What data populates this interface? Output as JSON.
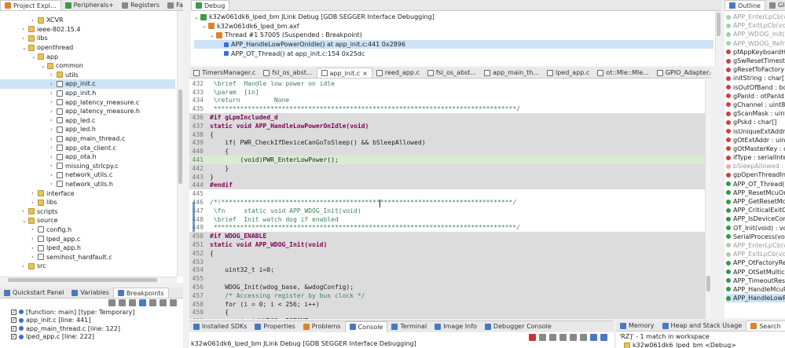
{
  "left_panel": {
    "tabs": [
      "Project Expl...",
      "Peripherals+",
      "Registers",
      "Faults"
    ],
    "tree": [
      {
        "label": "XCVR",
        "indent": 2,
        "arrow": "›",
        "icon": "folder"
      },
      {
        "label": "ieee-802.15.4",
        "indent": 1,
        "arrow": "›",
        "icon": "folder"
      },
      {
        "label": "libs",
        "indent": 1,
        "arrow": "›",
        "icon": "folder"
      },
      {
        "label": "openthread",
        "indent": 1,
        "arrow": "⌄",
        "icon": "folder"
      },
      {
        "label": "app",
        "indent": 2,
        "arrow": "⌄",
        "icon": "folder"
      },
      {
        "label": "common",
        "indent": 3,
        "arrow": "⌄",
        "icon": "folder"
      },
      {
        "label": "utils",
        "indent": 4,
        "arrow": "›",
        "icon": "folder"
      },
      {
        "label": "app_init.c",
        "indent": 4,
        "arrow": "›",
        "icon": "file",
        "selected": true
      },
      {
        "label": "app_init.h",
        "indent": 4,
        "arrow": "›",
        "icon": "h"
      },
      {
        "label": "app_latency_measure.c",
        "indent": 4,
        "arrow": "›",
        "icon": "file"
      },
      {
        "label": "app_latency_measure.h",
        "indent": 4,
        "arrow": "›",
        "icon": "h"
      },
      {
        "label": "app_led.c",
        "indent": 4,
        "arrow": "›",
        "icon": "file"
      },
      {
        "label": "app_led.h",
        "indent": 4,
        "arrow": "›",
        "icon": "h"
      },
      {
        "label": "app_main_thread.c",
        "indent": 4,
        "arrow": "›",
        "icon": "file"
      },
      {
        "label": "app_ota_client.c",
        "indent": 4,
        "arrow": "›",
        "icon": "file"
      },
      {
        "label": "app_ota.h",
        "indent": 4,
        "arrow": "›",
        "icon": "h"
      },
      {
        "label": "missing_strlcpy.c",
        "indent": 4,
        "arrow": "›",
        "icon": "file"
      },
      {
        "label": "network_utils.c",
        "indent": 4,
        "arrow": "›",
        "icon": "file"
      },
      {
        "label": "network_utils.h",
        "indent": 4,
        "arrow": "›",
        "icon": "h"
      },
      {
        "label": "interface",
        "indent": 2,
        "arrow": "›",
        "icon": "folder"
      },
      {
        "label": "libs",
        "indent": 2,
        "arrow": "›",
        "icon": "folder"
      },
      {
        "label": "scripts",
        "indent": 1,
        "arrow": "›",
        "icon": "folder"
      },
      {
        "label": "source",
        "indent": 1,
        "arrow": "⌄",
        "icon": "folder"
      },
      {
        "label": "config.h",
        "indent": 2,
        "arrow": "›",
        "icon": "h"
      },
      {
        "label": "lped_app.c",
        "indent": 2,
        "arrow": "›",
        "icon": "file"
      },
      {
        "label": "lped_app.h",
        "indent": 2,
        "arrow": "›",
        "icon": "h"
      },
      {
        "label": "semihost_hardfault.c",
        "indent": 2,
        "arrow": "›",
        "icon": "file"
      },
      {
        "label": "src",
        "indent": 1,
        "arrow": "›",
        "icon": "folder"
      }
    ]
  },
  "quickstart": {
    "tabs": [
      "Quickstart Panel",
      "Variables",
      "Breakpoints"
    ],
    "breakpoints": [
      {
        "label": "[function: main] [type: Temporary]"
      },
      {
        "label": "app_init.c [line: 441]"
      },
      {
        "label": "app_main_thread.c [line: 122]"
      },
      {
        "label": "lped_app.c [line: 222]"
      }
    ]
  },
  "debug": {
    "tab": "Debug",
    "rows": [
      {
        "label": "k32w061dk6_lped_bm JLink Debug [GDB SEGGER Interface Debugging]",
        "indent": 0,
        "arrow": "⌄"
      },
      {
        "label": "k32w061dk6_lped_bm.axf",
        "indent": 1,
        "arrow": "⌄"
      },
      {
        "label": "Thread #1 57005 (Suspended : Breakpoint)",
        "indent": 2,
        "arrow": "⌄"
      },
      {
        "label": "APP_HandleLowPowerOnIdle() at app_init.c:441 0x2896",
        "indent": 3,
        "arrow": "",
        "selected": true
      },
      {
        "label": "APP_OT_Thread() at app_init.c:154 0x25dc",
        "indent": 3,
        "arrow": ""
      }
    ]
  },
  "editor": {
    "tabs": [
      "TimersManager.c",
      "fsl_os_abst...",
      "app_init.c",
      "reed_app.c",
      "fsl_os_abst...",
      "app_main_th...",
      "lped_app.c",
      "ot::Mle::Mle...",
      "GPIO_Adapter.c"
    ],
    "overflow_tab": "»6",
    "lines": [
      {
        "n": "432",
        "text": " \\brief  Handle low power on idle",
        "cls": "cmt"
      },
      {
        "n": "433",
        "text": " \\param  [in]",
        "cls": "cmt"
      },
      {
        "n": "434",
        "text": " \\return         None",
        "cls": "cmt"
      },
      {
        "n": "435",
        "text": " ********************************************************************************/",
        "cls": "cmt"
      },
      {
        "n": "436",
        "text": "#if gLpmIncluded_d",
        "cls": "pp",
        "bg": "gray"
      },
      {
        "n": "437",
        "text": "static void APP_HandleLowPowerOnIdle(void)",
        "cls": "kw",
        "bg": "gray"
      },
      {
        "n": "438",
        "text": "{",
        "bg": "gray"
      },
      {
        "n": "439",
        "text": "    if( PWR_CheckIfDeviceCanGoToSleep() && bSleepAllowed)",
        "bg": "gray"
      },
      {
        "n": "440",
        "text": "    {",
        "bg": "gray"
      },
      {
        "n": "441",
        "text": "        (void)PWR_EnterLowPower();",
        "bg": "hl"
      },
      {
        "n": "442",
        "text": "    }",
        "bg": "gray"
      },
      {
        "n": "443",
        "text": "}",
        "bg": "gray"
      },
      {
        "n": "444",
        "text": "#endif",
        "cls": "pp",
        "bg": "gray"
      },
      {
        "n": "445",
        "text": ""
      },
      {
        "n": "446",
        "text": "/*!*****************************************************************************/",
        "cls": "cmt"
      },
      {
        "n": "447",
        "text": " \\fn     static void APP_WDOG_Init(void)",
        "cls": "cmt"
      },
      {
        "n": "448",
        "text": " \\brief  Init watch dog if enabled",
        "cls": "cmt"
      },
      {
        "n": "449",
        "text": " ********************************************************************************/",
        "cls": "cmt"
      },
      {
        "n": "450",
        "text": "#if WDOG_ENABLE",
        "cls": "pp",
        "bg": "gray"
      },
      {
        "n": "451",
        "text": "static void APP_WDOG_Init(void)",
        "cls": "kw",
        "bg": "gray"
      },
      {
        "n": "452",
        "text": "{",
        "bg": "gray"
      },
      {
        "n": "453",
        "text": "",
        "bg": "gray"
      },
      {
        "n": "454",
        "text": "    uint32_t i=0;",
        "bg": "gray"
      },
      {
        "n": "455",
        "text": "",
        "bg": "gray"
      },
      {
        "n": "456",
        "text": "    WDOG_Init(wdog_base, &wdogConfig);",
        "bg": "gray"
      },
      {
        "n": "457",
        "text": "    /* Accessing register by bus clock */",
        "cls": "cmt",
        "bg": "gray"
      },
      {
        "n": "458",
        "text": "    for (i = 0; i < 256; i++)",
        "bg": "gray"
      },
      {
        "n": "459",
        "text": "    {",
        "bg": "gray"
      },
      {
        "n": "460",
        "text": "        (void)WDOG->RSTCNT;",
        "bg": "gray"
      }
    ]
  },
  "bottom": {
    "tabs": [
      "Installed SDKs",
      "Properties",
      "Problems",
      "Console",
      "Terminal",
      "Image Info",
      "Debugger Console"
    ],
    "console_title": "k32w061dk6_lped_bm JLink Debug [GDB SEGGER Interface Debugging]"
  },
  "outline": {
    "tabs": [
      "Outline",
      "Global"
    ],
    "items": [
      {
        "label": "APP_EnterLpCb(vo",
        "kind": "method-muted"
      },
      {
        "label": "APP_ExitLpCb(vo",
        "kind": "method-muted"
      },
      {
        "label": "APP_WDOG_Init(v",
        "kind": "method-muted"
      },
      {
        "label": "APP_WDOG_Refre",
        "kind": "method-muted"
      },
      {
        "label": "pfAppKeyboardH",
        "kind": "var"
      },
      {
        "label": "gSwResetTimesta",
        "kind": "var"
      },
      {
        "label": "gResetToFactory",
        "kind": "var"
      },
      {
        "label": "initString : char[]",
        "kind": "var"
      },
      {
        "label": "isOutOfBand : bo",
        "kind": "var"
      },
      {
        "label": "gPanId : otPanId",
        "kind": "var"
      },
      {
        "label": "gChannel : uint8_",
        "kind": "var"
      },
      {
        "label": "gScanMask : uint3",
        "kind": "var"
      },
      {
        "label": "gPskd : char[]",
        "kind": "var"
      },
      {
        "label": "isUniqueExtAddr",
        "kind": "var"
      },
      {
        "label": "gOtExtAddr : uint",
        "kind": "var"
      },
      {
        "label": "gOtMasterKey : o",
        "kind": "var"
      },
      {
        "label": "ifType : serialInter",
        "kind": "var"
      },
      {
        "label": "bSleepAllowed : b",
        "kind": "var-muted"
      },
      {
        "label": "gpOpenThreadIns",
        "kind": "var"
      },
      {
        "label": "APP_OT_Thread(u",
        "kind": "method"
      },
      {
        "label": "APP_ResetMcuOn",
        "kind": "method"
      },
      {
        "label": "APP_GetResetMcu",
        "kind": "method"
      },
      {
        "label": "APP_CriticalExitC",
        "kind": "method"
      },
      {
        "label": "APP_IsDeviceCom",
        "kind": "method"
      },
      {
        "label": "OT_Init(void) : vo",
        "kind": "method"
      },
      {
        "label": "SerialProcess(voi",
        "kind": "method"
      },
      {
        "label": "APP_EnterLpCb(vo",
        "kind": "method-muted"
      },
      {
        "label": "APP_ExitLpCb(vo",
        "kind": "method-muted"
      },
      {
        "label": "APP_OtFactoryRes",
        "kind": "method"
      },
      {
        "label": "APP_OtSetMultica",
        "kind": "method"
      },
      {
        "label": "APP_TimeoutRese",
        "kind": "method"
      },
      {
        "label": "APP_HandleMcuR",
        "kind": "method"
      },
      {
        "label": "APP_HandleLowPo",
        "kind": "method",
        "selected": true
      }
    ]
  },
  "search_panel": {
    "tabs": [
      "Memory",
      "Heap and Stack Usage",
      "Search"
    ],
    "result": "'RZ]' - 1 match in workspace",
    "item": "k32w061dk6_lped_bm <Debug>"
  }
}
